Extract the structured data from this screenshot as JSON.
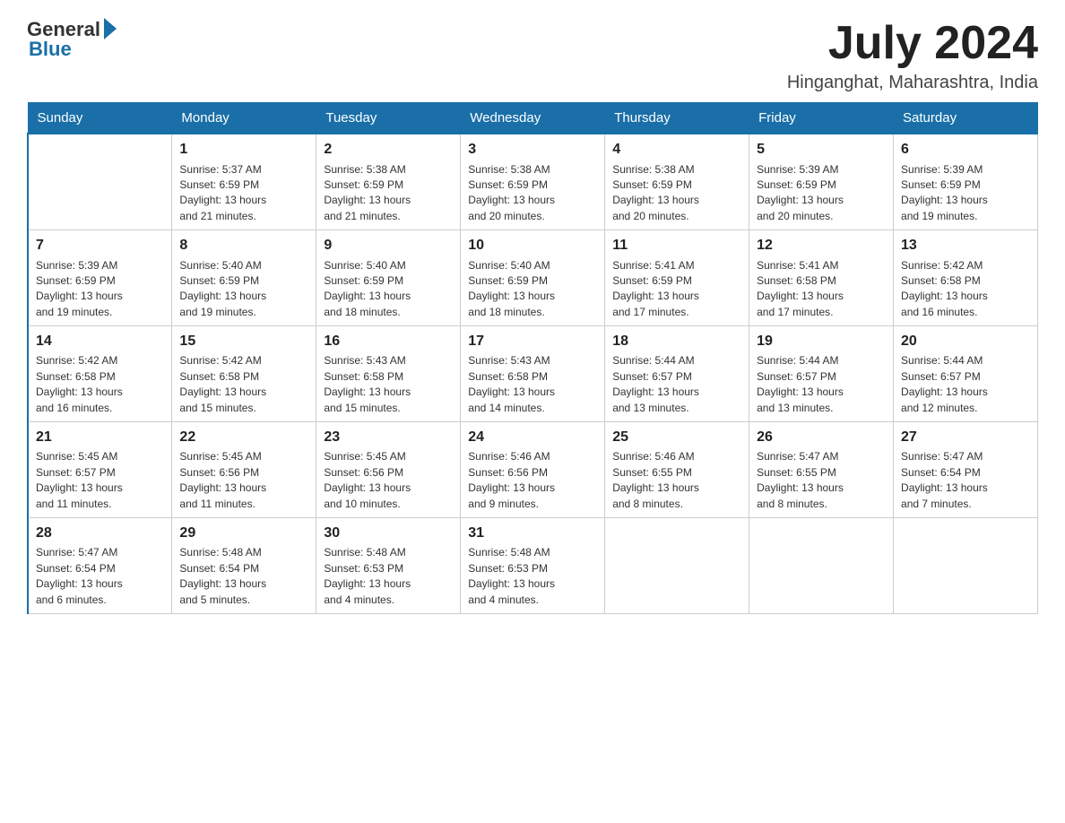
{
  "logo": {
    "general": "General",
    "blue": "Blue"
  },
  "title": {
    "month_year": "July 2024",
    "location": "Hinganghat, Maharashtra, India"
  },
  "days_of_week": [
    "Sunday",
    "Monday",
    "Tuesday",
    "Wednesday",
    "Thursday",
    "Friday",
    "Saturday"
  ],
  "weeks": [
    [
      {
        "day": "",
        "info": ""
      },
      {
        "day": "1",
        "info": "Sunrise: 5:37 AM\nSunset: 6:59 PM\nDaylight: 13 hours\nand 21 minutes."
      },
      {
        "day": "2",
        "info": "Sunrise: 5:38 AM\nSunset: 6:59 PM\nDaylight: 13 hours\nand 21 minutes."
      },
      {
        "day": "3",
        "info": "Sunrise: 5:38 AM\nSunset: 6:59 PM\nDaylight: 13 hours\nand 20 minutes."
      },
      {
        "day": "4",
        "info": "Sunrise: 5:38 AM\nSunset: 6:59 PM\nDaylight: 13 hours\nand 20 minutes."
      },
      {
        "day": "5",
        "info": "Sunrise: 5:39 AM\nSunset: 6:59 PM\nDaylight: 13 hours\nand 20 minutes."
      },
      {
        "day": "6",
        "info": "Sunrise: 5:39 AM\nSunset: 6:59 PM\nDaylight: 13 hours\nand 19 minutes."
      }
    ],
    [
      {
        "day": "7",
        "info": "Sunrise: 5:39 AM\nSunset: 6:59 PM\nDaylight: 13 hours\nand 19 minutes."
      },
      {
        "day": "8",
        "info": "Sunrise: 5:40 AM\nSunset: 6:59 PM\nDaylight: 13 hours\nand 19 minutes."
      },
      {
        "day": "9",
        "info": "Sunrise: 5:40 AM\nSunset: 6:59 PM\nDaylight: 13 hours\nand 18 minutes."
      },
      {
        "day": "10",
        "info": "Sunrise: 5:40 AM\nSunset: 6:59 PM\nDaylight: 13 hours\nand 18 minutes."
      },
      {
        "day": "11",
        "info": "Sunrise: 5:41 AM\nSunset: 6:59 PM\nDaylight: 13 hours\nand 17 minutes."
      },
      {
        "day": "12",
        "info": "Sunrise: 5:41 AM\nSunset: 6:58 PM\nDaylight: 13 hours\nand 17 minutes."
      },
      {
        "day": "13",
        "info": "Sunrise: 5:42 AM\nSunset: 6:58 PM\nDaylight: 13 hours\nand 16 minutes."
      }
    ],
    [
      {
        "day": "14",
        "info": "Sunrise: 5:42 AM\nSunset: 6:58 PM\nDaylight: 13 hours\nand 16 minutes."
      },
      {
        "day": "15",
        "info": "Sunrise: 5:42 AM\nSunset: 6:58 PM\nDaylight: 13 hours\nand 15 minutes."
      },
      {
        "day": "16",
        "info": "Sunrise: 5:43 AM\nSunset: 6:58 PM\nDaylight: 13 hours\nand 15 minutes."
      },
      {
        "day": "17",
        "info": "Sunrise: 5:43 AM\nSunset: 6:58 PM\nDaylight: 13 hours\nand 14 minutes."
      },
      {
        "day": "18",
        "info": "Sunrise: 5:44 AM\nSunset: 6:57 PM\nDaylight: 13 hours\nand 13 minutes."
      },
      {
        "day": "19",
        "info": "Sunrise: 5:44 AM\nSunset: 6:57 PM\nDaylight: 13 hours\nand 13 minutes."
      },
      {
        "day": "20",
        "info": "Sunrise: 5:44 AM\nSunset: 6:57 PM\nDaylight: 13 hours\nand 12 minutes."
      }
    ],
    [
      {
        "day": "21",
        "info": "Sunrise: 5:45 AM\nSunset: 6:57 PM\nDaylight: 13 hours\nand 11 minutes."
      },
      {
        "day": "22",
        "info": "Sunrise: 5:45 AM\nSunset: 6:56 PM\nDaylight: 13 hours\nand 11 minutes."
      },
      {
        "day": "23",
        "info": "Sunrise: 5:45 AM\nSunset: 6:56 PM\nDaylight: 13 hours\nand 10 minutes."
      },
      {
        "day": "24",
        "info": "Sunrise: 5:46 AM\nSunset: 6:56 PM\nDaylight: 13 hours\nand 9 minutes."
      },
      {
        "day": "25",
        "info": "Sunrise: 5:46 AM\nSunset: 6:55 PM\nDaylight: 13 hours\nand 8 minutes."
      },
      {
        "day": "26",
        "info": "Sunrise: 5:47 AM\nSunset: 6:55 PM\nDaylight: 13 hours\nand 8 minutes."
      },
      {
        "day": "27",
        "info": "Sunrise: 5:47 AM\nSunset: 6:54 PM\nDaylight: 13 hours\nand 7 minutes."
      }
    ],
    [
      {
        "day": "28",
        "info": "Sunrise: 5:47 AM\nSunset: 6:54 PM\nDaylight: 13 hours\nand 6 minutes."
      },
      {
        "day": "29",
        "info": "Sunrise: 5:48 AM\nSunset: 6:54 PM\nDaylight: 13 hours\nand 5 minutes."
      },
      {
        "day": "30",
        "info": "Sunrise: 5:48 AM\nSunset: 6:53 PM\nDaylight: 13 hours\nand 4 minutes."
      },
      {
        "day": "31",
        "info": "Sunrise: 5:48 AM\nSunset: 6:53 PM\nDaylight: 13 hours\nand 4 minutes."
      },
      {
        "day": "",
        "info": ""
      },
      {
        "day": "",
        "info": ""
      },
      {
        "day": "",
        "info": ""
      }
    ]
  ]
}
